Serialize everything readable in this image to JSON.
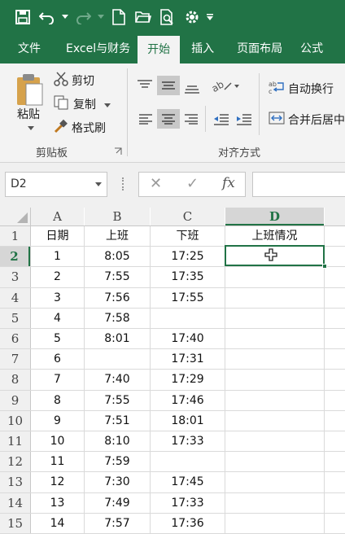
{
  "ribbon_tabs": [
    "文件",
    "Excel与财务",
    "开始",
    "插入",
    "页面布局",
    "公式"
  ],
  "active_tab_index": 2,
  "clipboard": {
    "paste_label": "粘贴",
    "cut_label": "剪切",
    "copy_label": "复制",
    "format_painter_label": "格式刷",
    "group_label": "剪贴板"
  },
  "alignment": {
    "wrap_text_label": "自动换行",
    "merge_center_label": "合并后居中",
    "group_label": "对齐方式"
  },
  "formula_bar": {
    "name_box": "D2",
    "cancel_glyph": "✕",
    "enter_glyph": "✓",
    "fx_glyph": "fx",
    "formula": ""
  },
  "sheet": {
    "columns": [
      "A",
      "B",
      "C",
      "D"
    ],
    "selected_column": "D",
    "selected_row": "2",
    "row_numbers": [
      "1",
      "2",
      "3",
      "4",
      "5",
      "6",
      "7",
      "8",
      "9",
      "10",
      "11",
      "12",
      "13",
      "14",
      "15"
    ],
    "rows": [
      [
        "日期",
        "上班",
        "下班",
        "上班情况"
      ],
      [
        "1",
        "8:05",
        "17:25",
        ""
      ],
      [
        "2",
        "7:55",
        "17:35",
        ""
      ],
      [
        "3",
        "7:56",
        "17:55",
        ""
      ],
      [
        "4",
        "7:58",
        "",
        ""
      ],
      [
        "5",
        "8:01",
        "17:40",
        ""
      ],
      [
        "6",
        "",
        "17:31",
        ""
      ],
      [
        "7",
        "7:40",
        "17:29",
        ""
      ],
      [
        "8",
        "7:55",
        "17:46",
        ""
      ],
      [
        "9",
        "7:51",
        "18:01",
        ""
      ],
      [
        "10",
        "8:10",
        "17:33",
        ""
      ],
      [
        "11",
        "7:59",
        "",
        ""
      ],
      [
        "12",
        "7:30",
        "17:45",
        ""
      ],
      [
        "13",
        "7:49",
        "17:33",
        ""
      ],
      [
        "14",
        "7:57",
        "17:36",
        ""
      ]
    ]
  },
  "colors": {
    "brand": "#217346",
    "ribbon_bg": "#f3f3f3",
    "grid_line": "#dadada"
  }
}
